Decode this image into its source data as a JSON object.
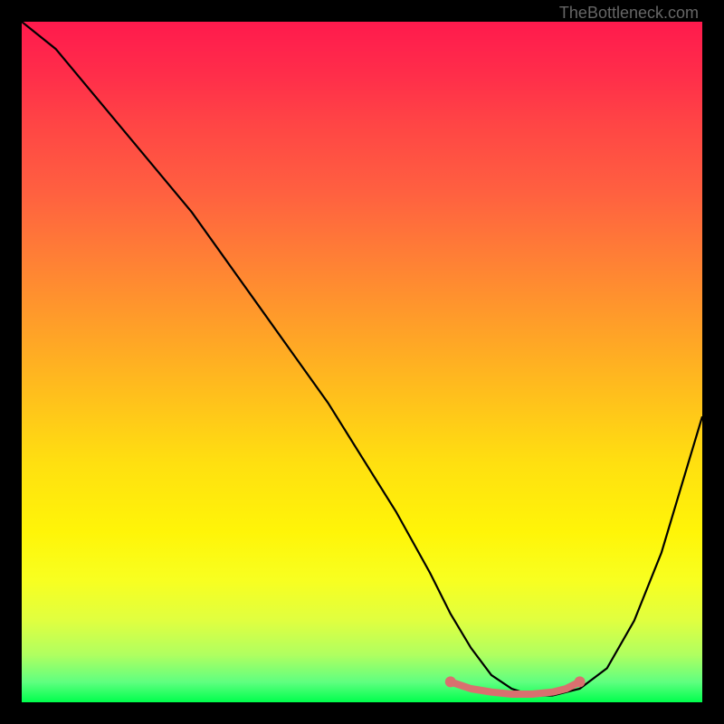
{
  "attribution": "TheBottleneck.com",
  "chart_data": {
    "type": "line",
    "title": "",
    "xlabel": "",
    "ylabel": "",
    "xlim": [
      0,
      100
    ],
    "ylim": [
      0,
      100
    ],
    "series": [
      {
        "name": "curve",
        "x": [
          0,
          5,
          10,
          15,
          20,
          25,
          30,
          35,
          40,
          45,
          50,
          55,
          60,
          63,
          66,
          69,
          72,
          75,
          78,
          82,
          86,
          90,
          94,
          97,
          100
        ],
        "values": [
          100,
          96,
          90,
          84,
          78,
          72,
          65,
          58,
          51,
          44,
          36,
          28,
          19,
          13,
          8,
          4,
          2,
          1,
          1,
          2,
          5,
          12,
          22,
          32,
          42
        ]
      }
    ],
    "markers": {
      "name": "valley-highlight",
      "color": "#d9706f",
      "points": [
        {
          "x": 63,
          "y": 3
        },
        {
          "x": 66,
          "y": 2
        },
        {
          "x": 69,
          "y": 1.5
        },
        {
          "x": 72,
          "y": 1.2
        },
        {
          "x": 75,
          "y": 1.2
        },
        {
          "x": 78,
          "y": 1.5
        },
        {
          "x": 80,
          "y": 2
        },
        {
          "x": 82,
          "y": 3
        }
      ]
    },
    "colors": {
      "curve": "#000000",
      "marker": "#d9706f",
      "background_top": "#ff1a4d",
      "background_bottom": "#00ff4d",
      "frame": "#000000"
    }
  }
}
